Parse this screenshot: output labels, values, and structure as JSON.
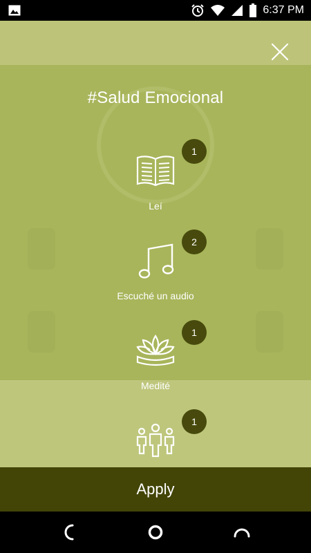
{
  "status_bar": {
    "time": "6:37 PM",
    "icons": [
      "image-notification-icon",
      "alarm-icon",
      "wifi-icon",
      "signal-icon",
      "battery-icon"
    ]
  },
  "dialog": {
    "title": "#Salud Emocional",
    "activities": [
      {
        "label": "Leí",
        "count": "1",
        "icon": "book-icon"
      },
      {
        "label": "Escuché un audio",
        "count": "2",
        "icon": "music-note-icon"
      },
      {
        "label": "Medité",
        "count": "1",
        "icon": "lotus-icon"
      },
      {
        "label": "",
        "count": "1",
        "icon": "people-group-icon"
      }
    ]
  },
  "apply_button": {
    "label": "Apply"
  },
  "colors": {
    "badge": "#474a0c",
    "apply_bar": "#434507",
    "overlay": "#a7b45a"
  }
}
